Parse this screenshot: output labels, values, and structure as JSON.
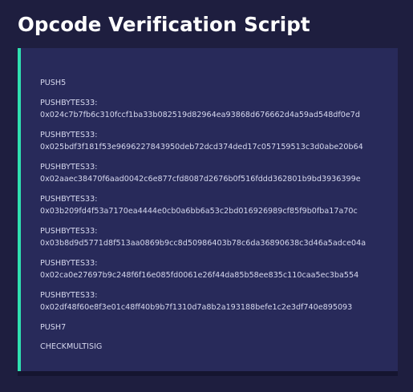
{
  "title": "Opcode Verification Script",
  "colors": {
    "background": "#1e1e3f",
    "panel": "#282a5a",
    "accent": "#2fe0b0",
    "title_text": "#ffffff",
    "script_text": "#d6d8ee"
  },
  "script": [
    {
      "op": "PUSH5"
    },
    {
      "op": "PUSHBYTES33:",
      "arg": "0x024c7b7fb6c310fccf1ba33b082519d82964ea93868d676662d4a59ad548df0e7d"
    },
    {
      "op": "PUSHBYTES33:",
      "arg": "0x025bdf3f181f53e9696227843950deb72dcd374ded17c057159513c3d0abe20b64"
    },
    {
      "op": "PUSHBYTES33:",
      "arg": "0x02aaec38470f6aad0042c6e877cfd8087d2676b0f516fddd362801b9bd3936399e"
    },
    {
      "op": "PUSHBYTES33:",
      "arg": "0x03b209fd4f53a7170ea4444e0cb0a6bb6a53c2bd016926989cf85f9b0fba17a70c"
    },
    {
      "op": "PUSHBYTES33:",
      "arg": "0x03b8d9d5771d8f513aa0869b9cc8d50986403b78c6da36890638c3d46a5adce04a"
    },
    {
      "op": "PUSHBYTES33:",
      "arg": "0x02ca0e27697b9c248f6f16e085fd0061e26f44da85b58ee835c110caa5ec3ba554"
    },
    {
      "op": "PUSHBYTES33:",
      "arg": "0x02df48f60e8f3e01c48ff40b9b7f1310d7a8b2a193188befe1c2e3df740e895093"
    },
    {
      "op": "PUSH7"
    },
    {
      "op": "CHECKMULTISIG"
    }
  ]
}
